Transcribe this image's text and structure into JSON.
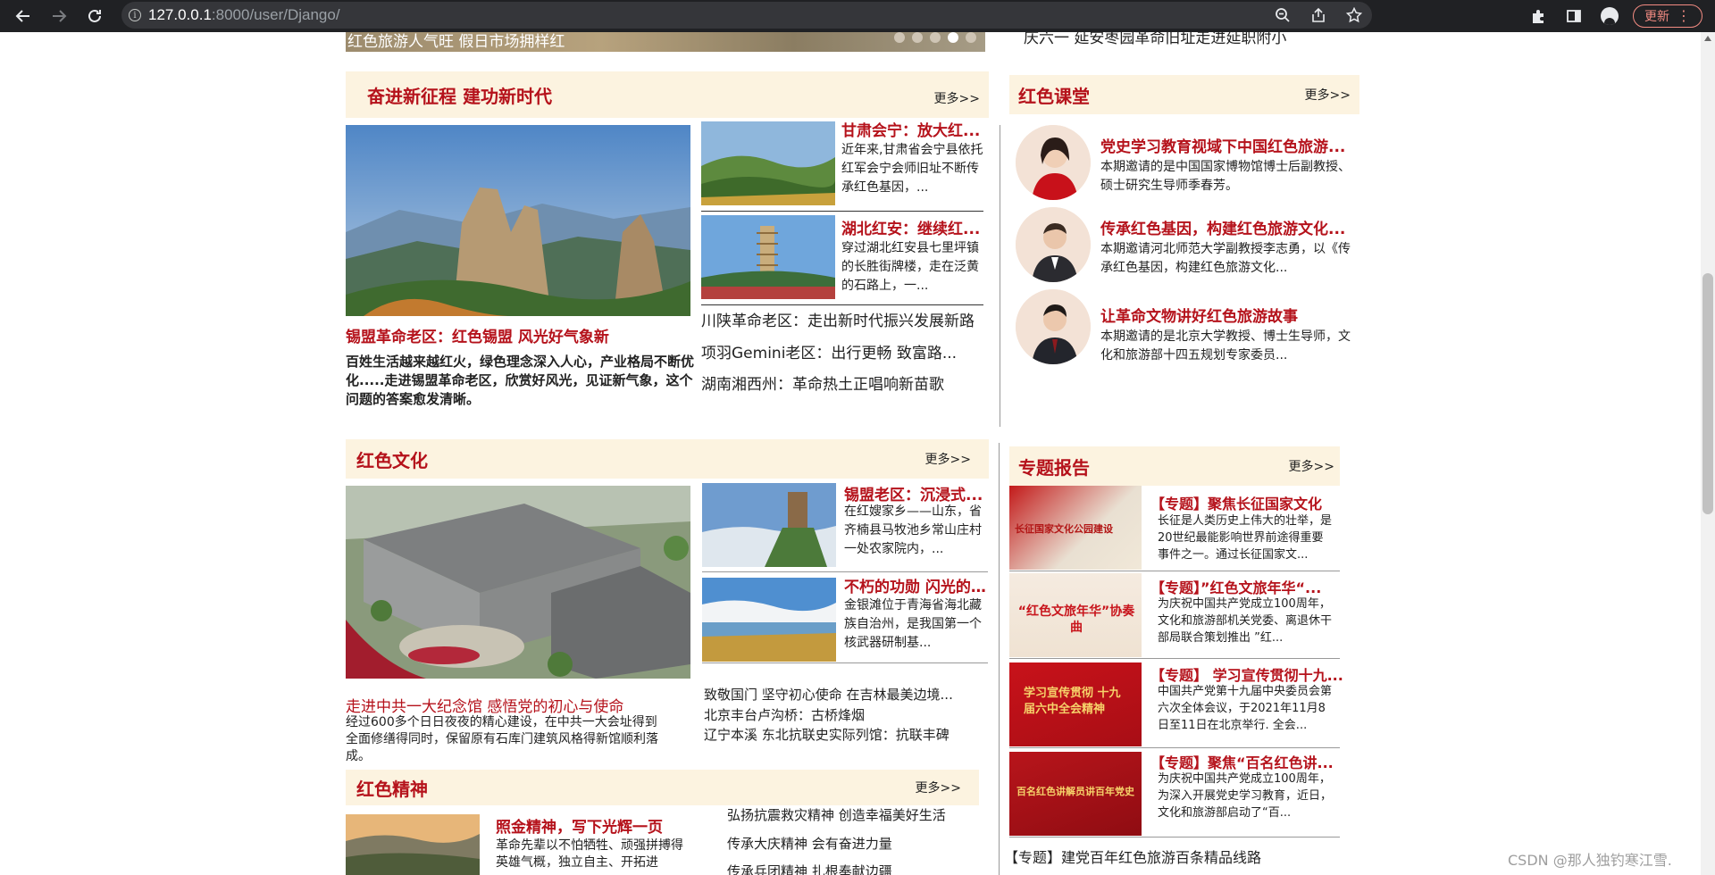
{
  "browser": {
    "url_host": "127.0.0.1",
    "url_port_path": ":8000/user/Django/",
    "update_label": "更新"
  },
  "top_strip": {
    "carousel_caption": "红色旅游人气旺 假日市场拥样红",
    "right_caption": "庆六一    延安枣园革命旧址走进延职附小"
  },
  "section1": {
    "title": "奋进新征程 建功新时代",
    "more": "更多>>",
    "feature": {
      "headline": "锡盟革命老区：红色锡盟 风光好气象新",
      "desc": "百姓生活越来越红火，绿色理念深入人心，产业格局不断优化.....走进锡盟革命老区，欣赏好风光，见证新气象，这个问题的答案愈发清晰。"
    },
    "items": [
      {
        "headline": "甘肃会宁：放大红...",
        "desc": "近年来,甘肃省会宁县依托红军会宁会师旧址不断传承红色基因，..."
      },
      {
        "headline": "湖北红安：继续红...",
        "desc": "穿过湖北红安县七里坪镇的长胜街牌楼，走在泛黄的石路上，一..."
      }
    ],
    "links": [
      "川陕革命老区：走出新时代振兴发展新路",
      "项羽Gemini老区：出行更畅 致富路...",
      "湖南湘西州：革命热土正唱响新苗歌"
    ]
  },
  "classroom": {
    "title": "红色课堂",
    "more": "更多>>",
    "items": [
      {
        "headline": "党史学习教育视域下中国红色旅游...",
        "desc": "本期邀请的是中国国家博物馆博士后副教授、硕士研究生导师季春芳。"
      },
      {
        "headline": "传承红色基因，构建红色旅游文化...",
        "desc": "本期邀请河北师范大学副教授李志勇，以《传承红色基因，构建红色旅游文化..."
      },
      {
        "headline": "让革命文物讲好红色旅游故事",
        "desc": "本期邀请的是北京大学教授、博士生导师，文化和旅游部十四五规划专家委员..."
      }
    ]
  },
  "culture": {
    "title": "红色文化",
    "more": "更多>>",
    "feature": {
      "headline": "走进中共一大纪念馆 感悟党的初心与使命",
      "desc": "经过600多个日日夜夜的精心建设，在中共一大会址得到全面修缮得同时，保留原有石库门建筑风格得新馆顺利落成。"
    },
    "items": [
      {
        "headline": "锡盟老区：沉浸式...",
        "desc": "在红嫂家乡——山东，省齐楠县马牧池乡常山庄村一处农家院内，..."
      },
      {
        "headline": "不朽的功勋 闪光的...",
        "desc": "金银滩位于青海省海北藏族自治州，是我国第一个核武器研制基..."
      }
    ],
    "links": [
      "致敬国门 坚守初心使命 在吉林最美边境...",
      "北京丰台卢沟桥：古桥烽烟",
      "辽宁本溪 东北抗联史实际列馆：抗联丰碑"
    ]
  },
  "reports": {
    "title": "专题报告",
    "more": "更多>>",
    "items": [
      {
        "headline": "【专题】聚焦长征国家文化",
        "desc": "长征是人类历史上伟大的壮举，是20世纪最能影响世界前途得重要事件之一。通过长征国家文...",
        "thumb": "长征国家文化公园建设"
      },
      {
        "headline": "【专题】”红色文旅年华“...",
        "desc": "为庆祝中国共产党成立100周年，文化和旅游部机关党委、离退休干部局联合策划推出 ”红...",
        "thumb": "“红色文旅年华”协奏曲"
      },
      {
        "headline": "【专题】 学习宣传贯彻十九...",
        "desc": "中国共产党第十九届中央委员会第六次全体会议，于2021年11月8日至11日在北京举行. 全会...",
        "thumb": "学习宣传贯彻 十九届六中全会精神"
      },
      {
        "headline": "【专题】聚焦“百名红色讲...",
        "desc": "为庆祝中国共产党成立100周年，为深入开展党史学习教育，近日，文化和旅游部启动了“百...",
        "thumb": "百名红色讲解员讲百年党史"
      }
    ],
    "footer_link": "【专题】建党百年红色旅游百条精品线路"
  },
  "spirit": {
    "title": "红色精神",
    "more": "更多>>",
    "feature": {
      "headline": "照金精神，写下光辉一页",
      "desc": "革命先辈以不怕牺牲、顽强拼搏得英雄气概，独立自主、开拓进"
    },
    "links": [
      "弘扬抗震救灾精神 创造幸福美好生活",
      "传承大庆精神 会有奋进力量",
      "传承兵团精神 扎根奉献边疆"
    ]
  },
  "watermark": "CSDN @那人独钓寒江雪."
}
